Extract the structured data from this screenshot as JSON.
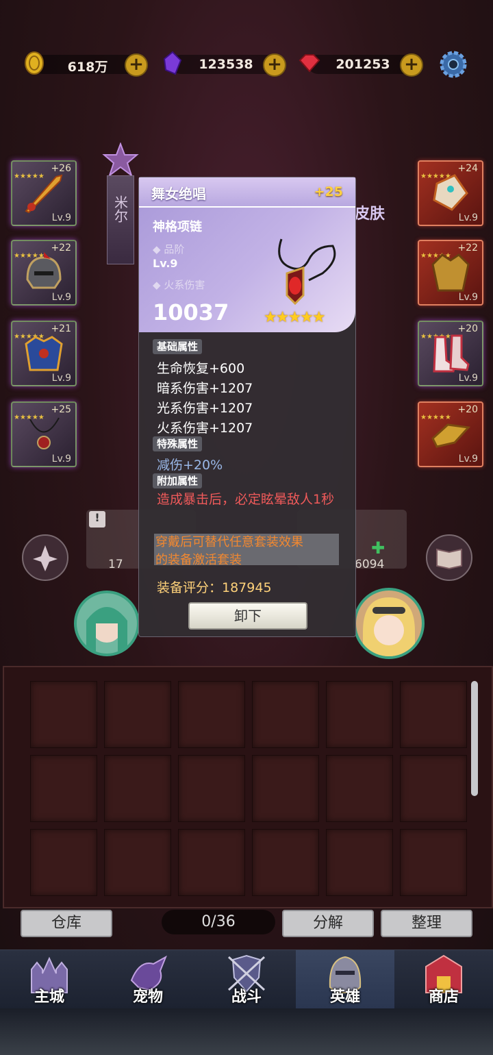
{
  "currency": {
    "gold": "618万",
    "crystal": "123538",
    "ruby": "201253"
  },
  "hero_banner": {
    "name": "米尔"
  },
  "skin_label": "皮肤",
  "left_slots": [
    {
      "plus": "+26",
      "level": "Lv.9"
    },
    {
      "plus": "+22",
      "level": "Lv.9"
    },
    {
      "plus": "+21",
      "level": "Lv.9"
    },
    {
      "plus": "+25",
      "level": "Lv.9"
    }
  ],
  "right_slots": [
    {
      "plus": "+24",
      "level": "Lv.9"
    },
    {
      "plus": "+22",
      "level": "Lv.9"
    },
    {
      "plus": "+20",
      "level": "Lv.9"
    },
    {
      "plus": "+20",
      "level": "Lv.9"
    }
  ],
  "partial_stats": {
    "left": "17",
    "right": "6094"
  },
  "popup": {
    "title": "舞女绝唱",
    "plus": "+25",
    "item_name": "神格项链",
    "quality_label": "品阶",
    "level": "Lv.9",
    "element_label": "火系伤害",
    "score": "10037",
    "stars": "★★★★★",
    "star_count": 5,
    "basic_header": "基础属性",
    "basic": [
      "生命恢复+600",
      "暗系伤害+1207",
      "光系伤害+1207",
      "火系伤害+1207"
    ],
    "special_header": "特殊属性",
    "special": [
      "减伤+20%"
    ],
    "extra_header": "附加属性",
    "extra": "造成暴击后，必定眩晕敌人1秒",
    "set_line1": "穿戴后可替代任意套装效果",
    "set_line2": "的装备激活套装",
    "rating": "装备评分：187945",
    "unequip": "卸下"
  },
  "inventory": {
    "warehouse": "仓库",
    "count": "0/36",
    "decompose": "分解",
    "sort": "整理"
  },
  "nav": {
    "tabs": [
      "主城",
      "宠物",
      "战斗",
      "英雄",
      "商店"
    ],
    "active": "英雄"
  },
  "colors": {
    "popup_head": "#b8a8e0",
    "rating": "#ffd27a",
    "set_text": "#f28830",
    "extra_text": "#f05a5a",
    "special_text": "#9ab8e8"
  }
}
